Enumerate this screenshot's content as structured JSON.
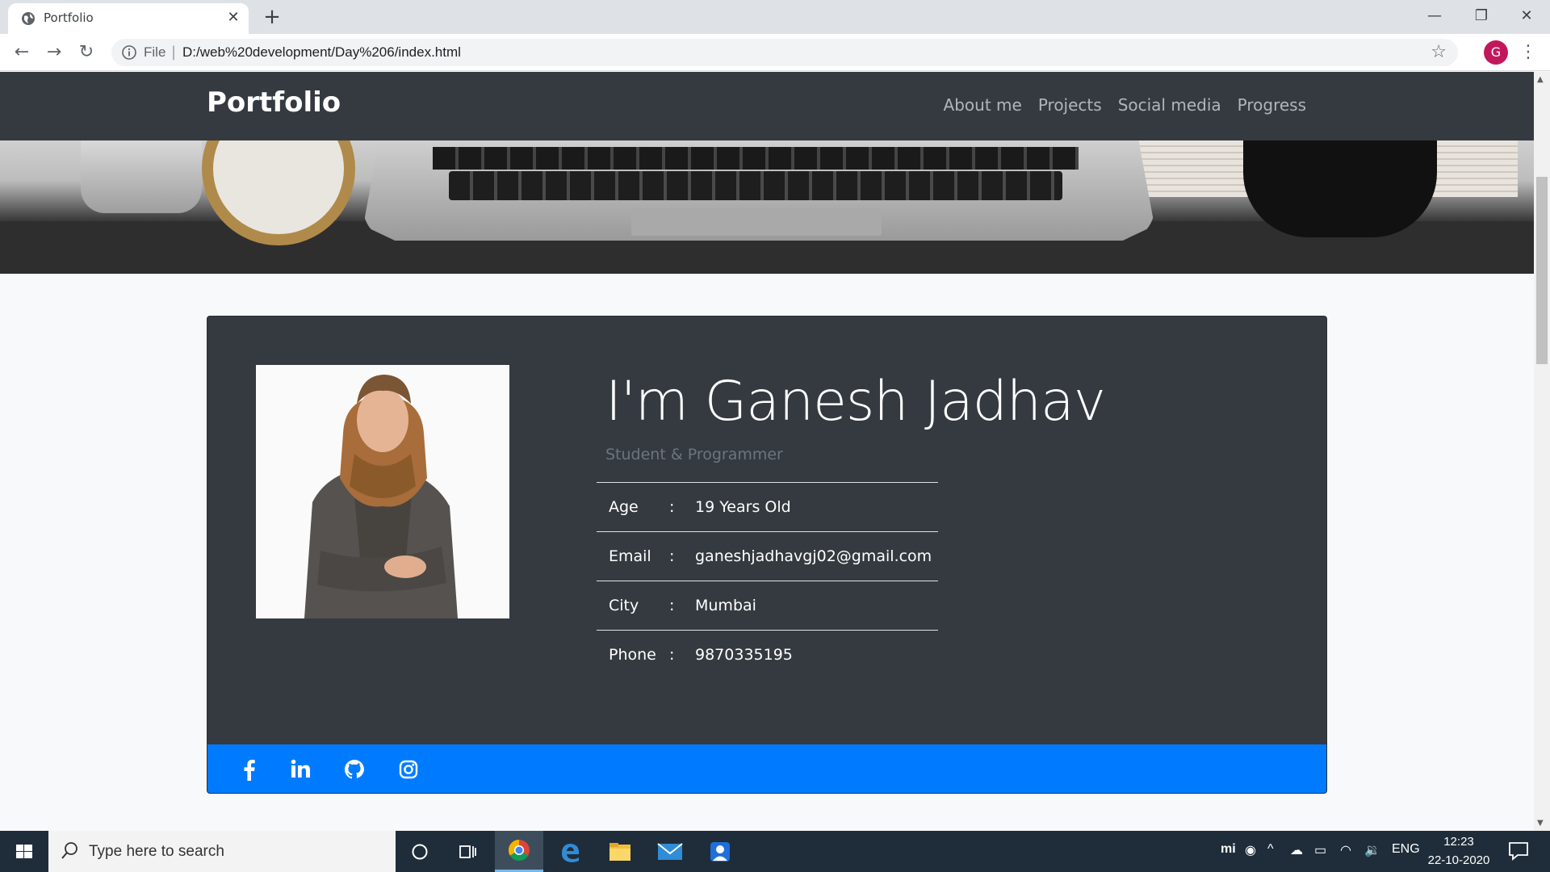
{
  "browser": {
    "tab_title": "Portfolio",
    "address_scheme": "File",
    "address_url": "D:/web%20development/Day%206/index.html",
    "profile_initial": "G"
  },
  "page": {
    "brand": "Portfolio",
    "nav_links": [
      "About me",
      "Projects",
      "Social media",
      "Progress"
    ],
    "profile": {
      "name": "I'm Ganesh Jadhav",
      "tagline": "Student & Programmer",
      "rows": [
        {
          "key": "Age",
          "sep": ":",
          "value": "19 Years Old"
        },
        {
          "key": "Email",
          "sep": ":",
          "value": "ganeshjadhavgj02@gmail.com"
        },
        {
          "key": "City",
          "sep": ":",
          "value": "Mumbai"
        },
        {
          "key": "Phone",
          "sep": ":",
          "value": "9870335195"
        }
      ],
      "social_icons": [
        "facebook-icon",
        "linkedin-icon",
        "github-icon",
        "instagram-icon"
      ]
    },
    "colors": {
      "navbar": "#343a40",
      "card": "#343a40",
      "footer_blue": "#007bff",
      "page_bg": "#f8f9fa"
    }
  },
  "taskbar": {
    "search_placeholder": "Type here to search",
    "language": "ENG",
    "time": "12:23",
    "date": "22-10-2020"
  }
}
